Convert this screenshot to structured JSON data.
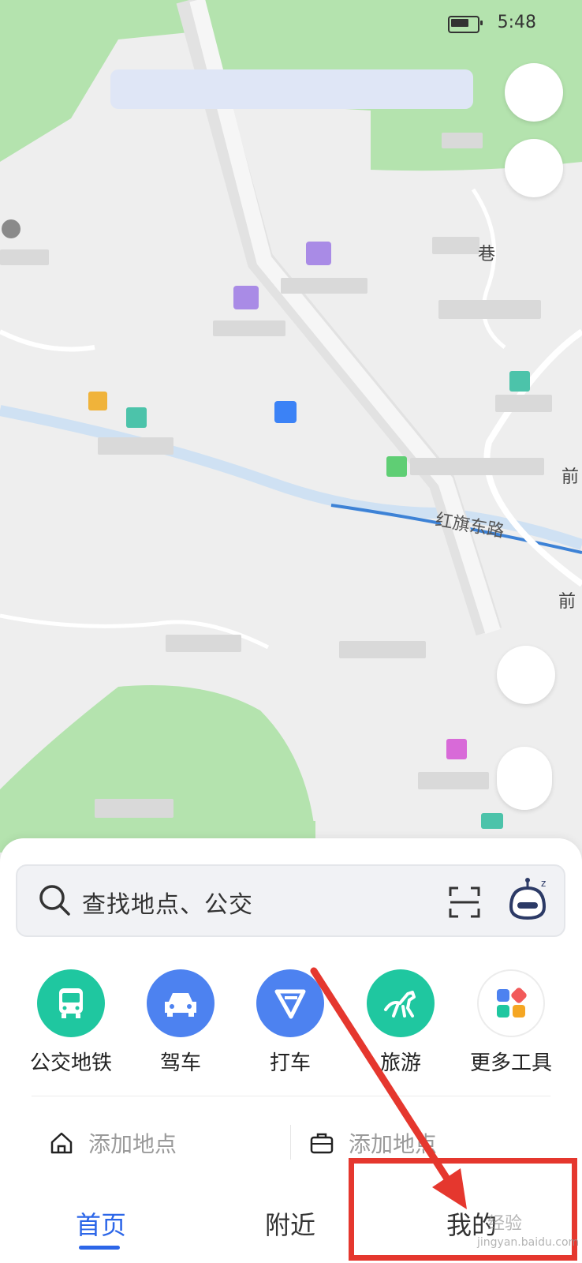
{
  "status_bar": {
    "time": "5:48"
  },
  "map": {
    "labels": [
      "前",
      "前",
      "红旗东路",
      "巷"
    ]
  },
  "search": {
    "placeholder": "查找地点、公交"
  },
  "shortcuts": [
    {
      "label": "公交地铁",
      "icon": "bus-icon",
      "color": "#1fc7a0"
    },
    {
      "label": "驾车",
      "icon": "car-icon",
      "color": "#4d82f0"
    },
    {
      "label": "打车",
      "icon": "taxi-icon",
      "color": "#4d82f0"
    },
    {
      "label": "旅游",
      "icon": "horse-icon",
      "color": "#1fc7a0"
    },
    {
      "label": "更多工具",
      "icon": "grid-icon",
      "color": "#ffffff"
    }
  ],
  "places": [
    {
      "label": "添加地点",
      "icon": "home-icon"
    },
    {
      "label": "添加地点",
      "icon": "briefcase-icon"
    }
  ],
  "tabs": [
    {
      "label": "首页",
      "active": true
    },
    {
      "label": "附近",
      "active": false
    },
    {
      "label": "我的",
      "active": false
    }
  ],
  "watermark": {
    "text": "经验",
    "sub": "jingyan.baidu.com"
  },
  "colors": {
    "accent": "#2c66e8",
    "annotation": "#e5372e"
  }
}
